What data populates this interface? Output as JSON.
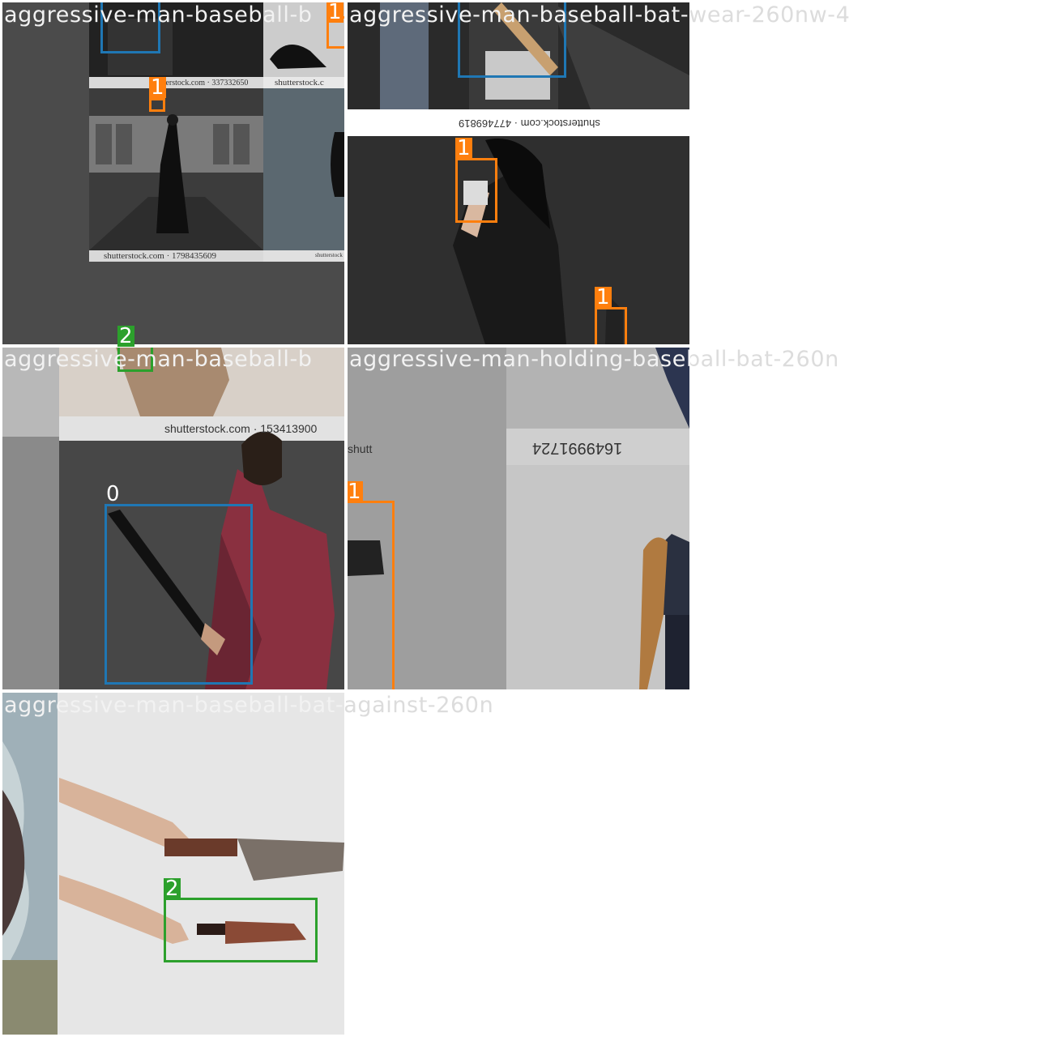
{
  "colors": {
    "class_0": "#1f77b4",
    "class_1": "#ff7f0e",
    "class_2": "#2ca02c"
  },
  "tiles": [
    {
      "caption": "aggressive-man-baseball-b",
      "boxes": [
        {
          "class": "1"
        },
        {
          "class": "1"
        }
      ],
      "watermarks": [
        "shutterstock.com · 337332650",
        "shutterstock.c",
        "shutterstock.com · 1798435609",
        "shutterstock"
      ]
    },
    {
      "caption": "aggressive-man-baseball-bat-wear-260nw-4",
      "boxes": [
        {
          "class": "1"
        },
        {
          "class": "1"
        },
        {
          "class": "1"
        }
      ],
      "watermarks": [
        "shutterstock.com · 477469819"
      ]
    },
    {
      "caption": "aggressive-man-baseball-b",
      "boxes": [
        {
          "class": "2"
        },
        {
          "class": "0"
        }
      ],
      "watermarks": [
        "shutterstock.com · 153413900"
      ]
    },
    {
      "caption": "aggressive-man-holding-baseball-bat-260n",
      "boxes": [
        {
          "class": "1"
        }
      ],
      "watermarks": [
        "shutt",
        "1649991724"
      ]
    },
    {
      "caption": "aggressive-man-baseball-bat-against-260n",
      "boxes": [
        {
          "class": "2"
        }
      ],
      "watermarks": []
    }
  ]
}
